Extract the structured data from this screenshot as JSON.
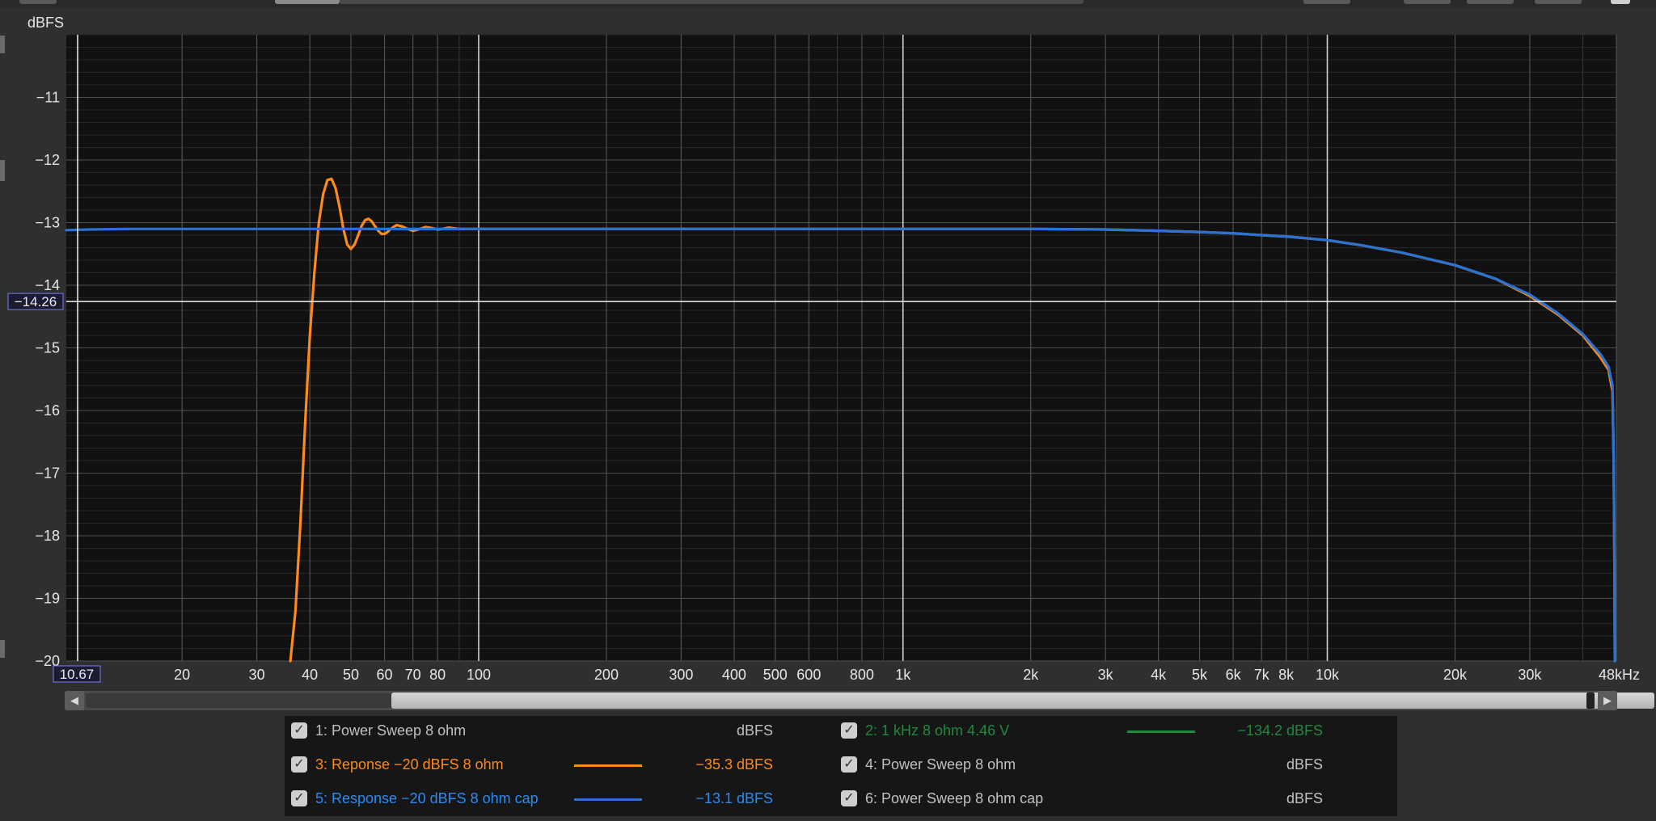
{
  "chart_data": {
    "type": "line",
    "ylabel": "dBFS",
    "xscale": "log",
    "xlim": [
      10.67,
      48000
    ],
    "ylim": [
      -20,
      -10
    ],
    "grid": true,
    "y_ticks": [
      {
        "v": -11,
        "label": "−11"
      },
      {
        "v": -12,
        "label": "−12"
      },
      {
        "v": -13,
        "label": "−13"
      },
      {
        "v": -14,
        "label": "−14"
      },
      {
        "v": -15,
        "label": "−15"
      },
      {
        "v": -16,
        "label": "−16"
      },
      {
        "v": -17,
        "label": "−17"
      },
      {
        "v": -18,
        "label": "−18"
      },
      {
        "v": -19,
        "label": "−19"
      },
      {
        "v": -20,
        "label": "−20"
      }
    ],
    "x_ticks": [
      {
        "v": 20,
        "label": "20"
      },
      {
        "v": 30,
        "label": "30"
      },
      {
        "v": 40,
        "label": "40"
      },
      {
        "v": 50,
        "label": "50"
      },
      {
        "v": 60,
        "label": "60"
      },
      {
        "v": 70,
        "label": "70"
      },
      {
        "v": 80,
        "label": "80"
      },
      {
        "v": 100,
        "label": "100"
      },
      {
        "v": 200,
        "label": "200"
      },
      {
        "v": 300,
        "label": "300"
      },
      {
        "v": 400,
        "label": "400"
      },
      {
        "v": 500,
        "label": "500"
      },
      {
        "v": 600,
        "label": "600"
      },
      {
        "v": 800,
        "label": "800"
      },
      {
        "v": 1000,
        "label": "1k"
      },
      {
        "v": 2000,
        "label": "2k"
      },
      {
        "v": 3000,
        "label": "3k"
      },
      {
        "v": 4000,
        "label": "4k"
      },
      {
        "v": 5000,
        "label": "5k"
      },
      {
        "v": 6000,
        "label": "6k"
      },
      {
        "v": 7000,
        "label": "7k"
      },
      {
        "v": 8000,
        "label": "8k"
      },
      {
        "v": 10000,
        "label": "10k"
      },
      {
        "v": 20000,
        "label": "20k"
      },
      {
        "v": 30000,
        "label": "30k"
      },
      {
        "v": 48000,
        "label": "48kHz"
      }
    ],
    "cursor": {
      "x": 10.67,
      "x_label": "10.67",
      "y": -14.26,
      "y_label": "−14.26"
    },
    "series": [
      {
        "name": "Reponse −20 dBFS 8 ohm",
        "color": "#ff8a1c",
        "points": [
          [
            36,
            -20.0
          ],
          [
            37,
            -19.2
          ],
          [
            38,
            -17.8
          ],
          [
            39,
            -16.2
          ],
          [
            40,
            -14.8
          ],
          [
            41,
            -13.8
          ],
          [
            42,
            -13.0
          ],
          [
            43,
            -12.55
          ],
          [
            44,
            -12.32
          ],
          [
            45,
            -12.3
          ],
          [
            46,
            -12.45
          ],
          [
            47,
            -12.75
          ],
          [
            48,
            -13.1
          ],
          [
            49,
            -13.35
          ],
          [
            50,
            -13.42
          ],
          [
            51,
            -13.35
          ],
          [
            52,
            -13.2
          ],
          [
            53,
            -13.05
          ],
          [
            54,
            -12.96
          ],
          [
            55,
            -12.94
          ],
          [
            56,
            -12.98
          ],
          [
            57,
            -13.06
          ],
          [
            58,
            -13.13
          ],
          [
            59,
            -13.18
          ],
          [
            60,
            -13.18
          ],
          [
            61,
            -13.15
          ],
          [
            62,
            -13.1
          ],
          [
            64,
            -13.04
          ],
          [
            66,
            -13.06
          ],
          [
            68,
            -13.1
          ],
          [
            70,
            -13.13
          ],
          [
            72,
            -13.11
          ],
          [
            75,
            -13.07
          ],
          [
            78,
            -13.09
          ],
          [
            80,
            -13.11
          ],
          [
            82,
            -13.1
          ],
          [
            85,
            -13.08
          ],
          [
            90,
            -13.1
          ],
          [
            100,
            -13.1
          ],
          [
            200,
            -13.1
          ],
          [
            500,
            -13.1
          ],
          [
            1000,
            -13.1
          ],
          [
            2000,
            -13.1
          ],
          [
            3000,
            -13.11
          ],
          [
            4000,
            -13.13
          ],
          [
            5000,
            -13.15
          ],
          [
            6000,
            -13.17
          ],
          [
            7000,
            -13.2
          ],
          [
            8000,
            -13.22
          ],
          [
            10000,
            -13.28
          ],
          [
            12000,
            -13.36
          ],
          [
            15000,
            -13.48
          ],
          [
            20000,
            -13.68
          ],
          [
            25000,
            -13.9
          ],
          [
            30000,
            -14.17
          ],
          [
            35000,
            -14.47
          ],
          [
            40000,
            -14.8
          ],
          [
            44000,
            -15.15
          ],
          [
            46000,
            -15.35
          ],
          [
            47000,
            -15.7
          ],
          [
            47300,
            -16.8
          ],
          [
            47500,
            -18.5
          ],
          [
            47600,
            -20.0
          ]
        ]
      },
      {
        "name": "Response −20 dBFS 8 ohm cap",
        "color": "#2a72d4",
        "points": [
          [
            10.67,
            -13.12
          ],
          [
            12,
            -13.11
          ],
          [
            15,
            -13.1
          ],
          [
            20,
            -13.1
          ],
          [
            50,
            -13.1
          ],
          [
            100,
            -13.1
          ],
          [
            200,
            -13.1
          ],
          [
            500,
            -13.1
          ],
          [
            1000,
            -13.1
          ],
          [
            2000,
            -13.1
          ],
          [
            3000,
            -13.11
          ],
          [
            4000,
            -13.13
          ],
          [
            5000,
            -13.15
          ],
          [
            6000,
            -13.17
          ],
          [
            7000,
            -13.2
          ],
          [
            8000,
            -13.22
          ],
          [
            10000,
            -13.28
          ],
          [
            12000,
            -13.36
          ],
          [
            15000,
            -13.48
          ],
          [
            20000,
            -13.68
          ],
          [
            25000,
            -13.9
          ],
          [
            30000,
            -14.15
          ],
          [
            35000,
            -14.45
          ],
          [
            40000,
            -14.78
          ],
          [
            44000,
            -15.1
          ],
          [
            46000,
            -15.3
          ],
          [
            47000,
            -15.6
          ],
          [
            47300,
            -16.8
          ],
          [
            47500,
            -18.5
          ],
          [
            47600,
            -20.0
          ]
        ]
      }
    ]
  },
  "legend": {
    "items": [
      {
        "label": "1: Power Sweep 8 ohm",
        "value": "dBFS",
        "color": "#c0c0c0",
        "line_color": "",
        "checked": true
      },
      {
        "label": "2: 1 kHz 8 ohm 4.46 V",
        "value": "−134.2 dBFS",
        "color": "#1f8a3c",
        "line_color": "#1f8a3c",
        "checked": true
      },
      {
        "label": "3: Reponse −20 dBFS 8 ohm",
        "value": "−35.3 dBFS",
        "color": "#ff8a1c",
        "line_color": "#ff8a1c",
        "checked": true
      },
      {
        "label": "4: Power Sweep 8 ohm",
        "value": "dBFS",
        "color": "#c0c0c0",
        "line_color": "",
        "checked": true
      },
      {
        "label": "5: Response −20 dBFS 8 ohm cap",
        "value": "−13.1 dBFS",
        "color": "#2a8cf0",
        "line_color": "#2a72d4",
        "checked": true
      },
      {
        "label": "6: Power Sweep 8 ohm cap",
        "value": "dBFS",
        "color": "#c0c0c0",
        "line_color": "",
        "checked": true
      }
    ]
  },
  "scrollbar": {
    "left_arrow": "◀",
    "right_arrow": "▶"
  }
}
